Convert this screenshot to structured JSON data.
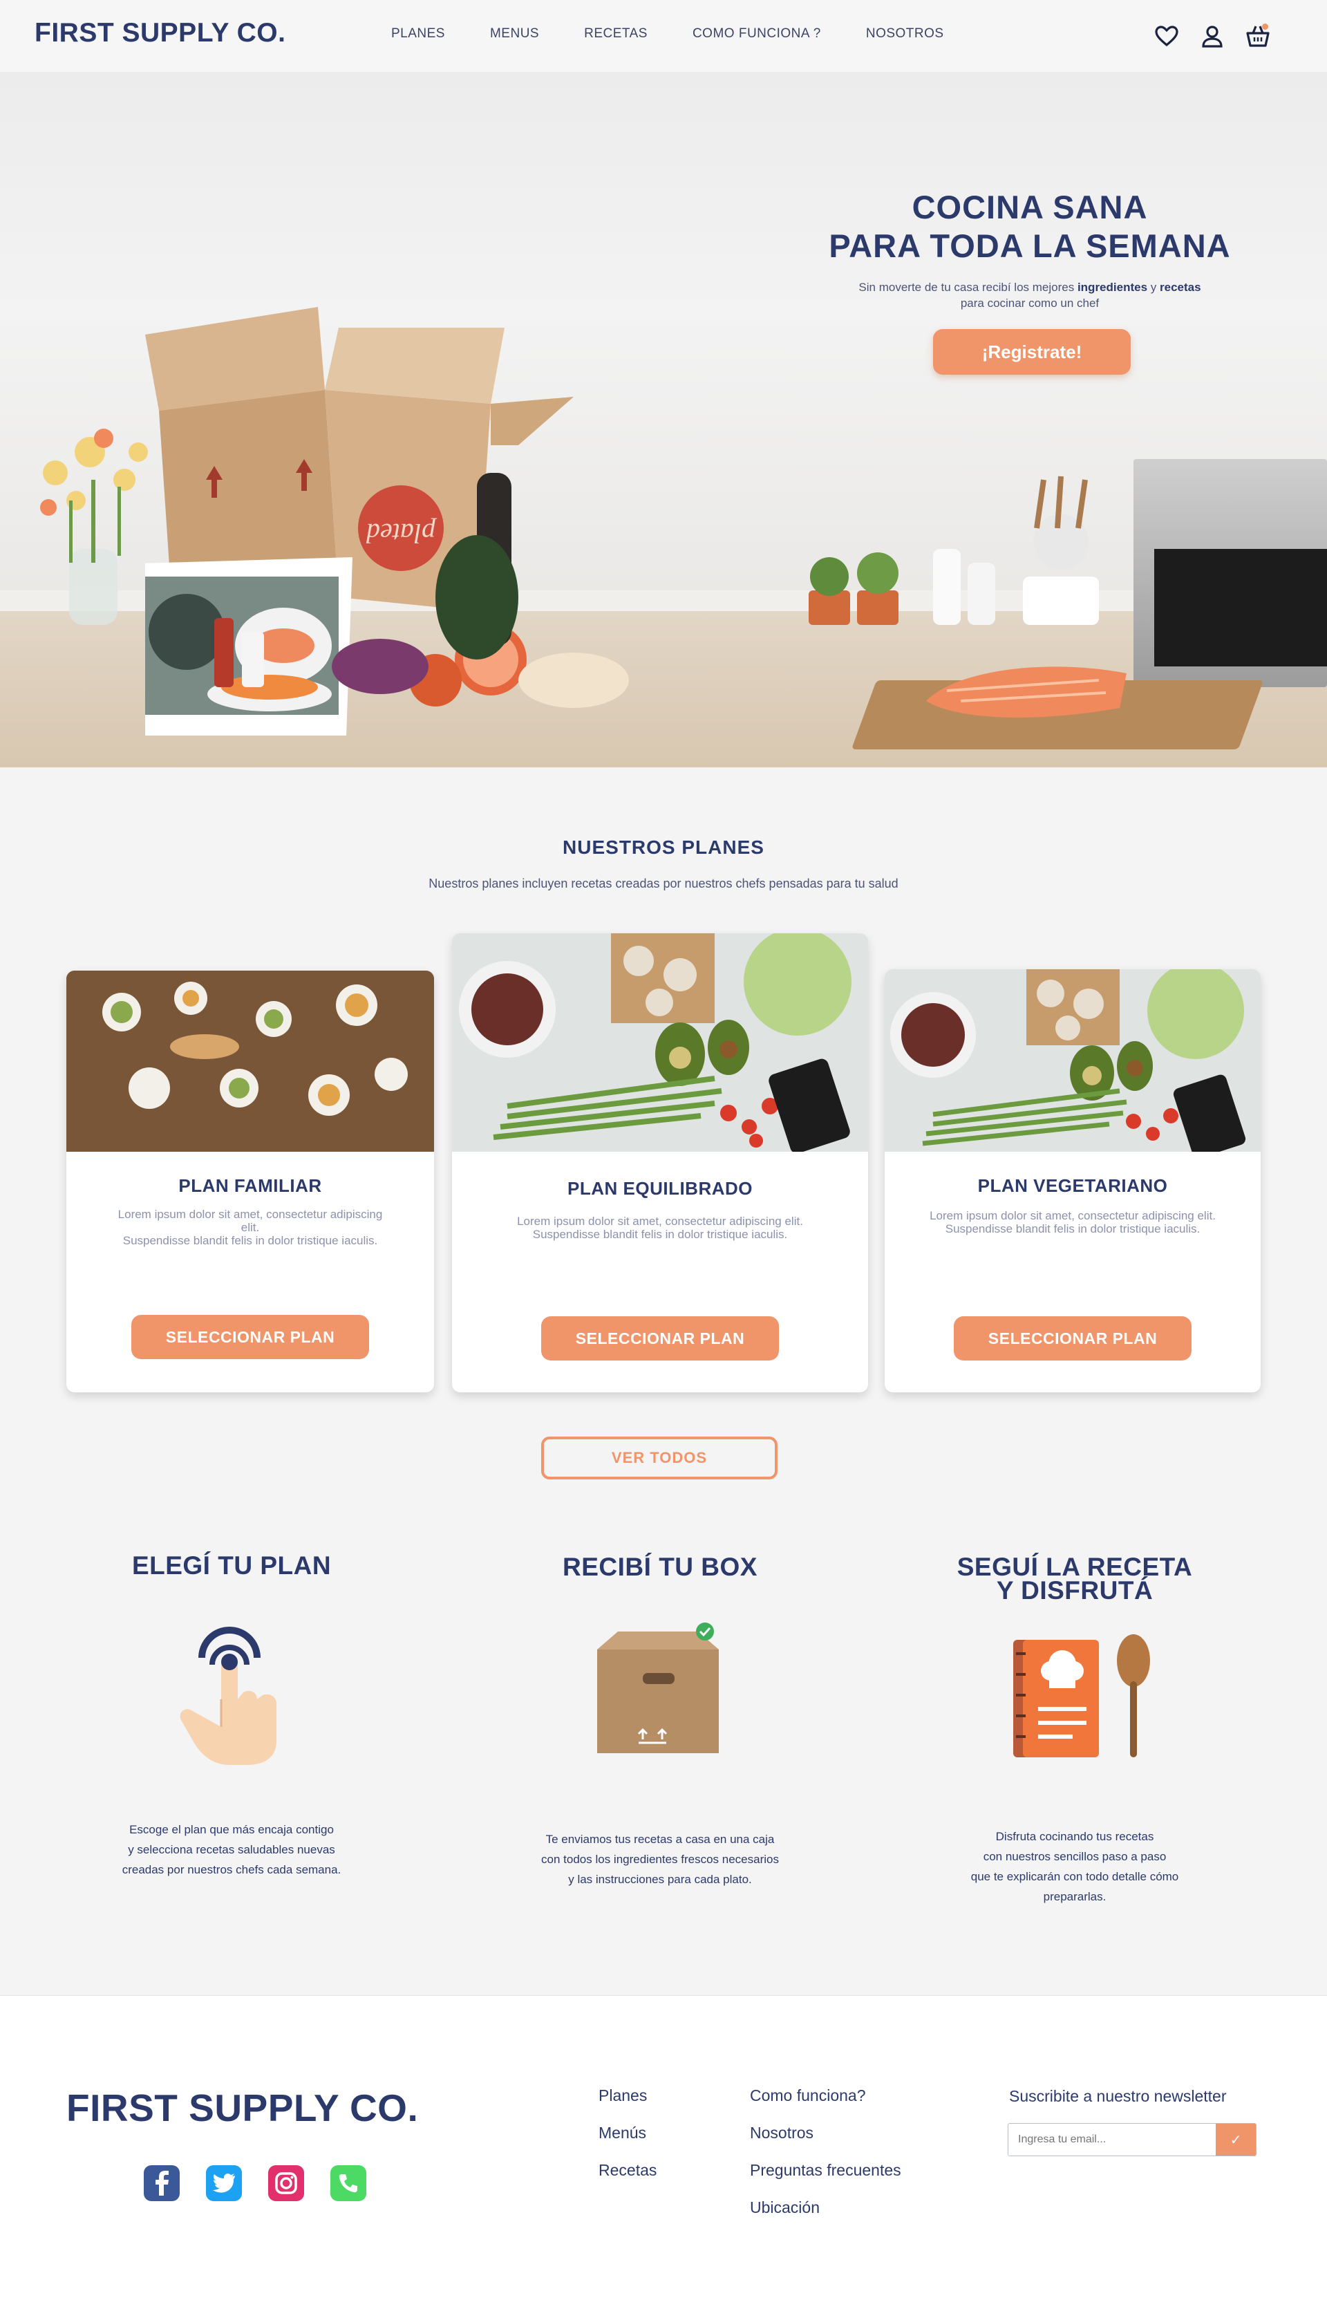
{
  "header": {
    "logo": "FIRST SUPPLY CO.",
    "menu": [
      "PLANES",
      "MENUS",
      "RECETAS",
      "COMO FUNCIONA ?",
      "NOSOTROS"
    ],
    "icons": [
      "heart-icon",
      "user-icon",
      "basket-icon"
    ]
  },
  "hero": {
    "title_line1": "COCINA SANA",
    "title_line2": "PARA TODA LA SEMANA",
    "subtitle_pre": "Sin moverte de tu casa recibí los mejores ",
    "subtitle_bold1": "ingredientes",
    "subtitle_mid": " y ",
    "subtitle_bold2": "recetas",
    "subtitle_line2": "para cocinar como un chef",
    "cta": "¡Registrate!",
    "box_brand": "plated"
  },
  "plans": {
    "title": "NUESTROS  PLANES",
    "subtitle": "Nuestros planes incluyen recetas creadas por nuestros chefs pensadas para tu salud",
    "cards": [
      {
        "name": "PLAN FAMILIAR",
        "desc1": "Lorem ipsum dolor sit amet, consectetur adipiscing elit.",
        "desc2": "Suspendisse blandit felis in dolor tristique iaculis.",
        "button": "SELECCIONAR PLAN"
      },
      {
        "name": "PLAN EQUILIBRADO",
        "desc1": "Lorem ipsum dolor sit amet, consectetur adipiscing elit.",
        "desc2": "Suspendisse blandit felis in dolor tristique iaculis.",
        "button": "SELECCIONAR PLAN"
      },
      {
        "name": "PLAN VEGETARIANO",
        "desc1": "Lorem ipsum dolor sit amet, consectetur adipiscing elit.",
        "desc2": "Suspendisse blandit felis in dolor tristique iaculis.",
        "button": "SELECCIONAR PLAN"
      }
    ],
    "see_all": "VER TODOS"
  },
  "steps": [
    {
      "title": "ELEGÍ TU PLAN",
      "icon": "tap-hand-icon",
      "text": [
        "Escoge el plan que más encaja contigo",
        "y selecciona recetas saludables nuevas",
        "creadas por nuestros chefs cada semana."
      ]
    },
    {
      "title": "RECIBÍ TU BOX",
      "icon": "box-icon",
      "text": [
        "Te enviamos tus recetas a casa en una caja",
        "con todos los ingredientes frescos necesarios",
        "y las instrucciones para cada plato."
      ]
    },
    {
      "title_line1": "SEGUÍ LA RECETA",
      "title_line2": "Y DISFRUTÁ",
      "icon": "recipe-book-icon",
      "text": [
        "Disfruta cocinando tus recetas",
        "con nuestros sencillos paso a paso",
        "que te explicarán con todo detalle cómo",
        "prepararlas."
      ]
    }
  ],
  "footer": {
    "logo": "FIRST SUPPLY CO.",
    "socials": [
      "facebook-icon",
      "twitter-icon",
      "instagram-icon",
      "phone-icon"
    ],
    "col1": [
      "Planes",
      "Menús",
      "Recetas"
    ],
    "col2": [
      "Como funciona?",
      "Nosotros",
      "Preguntas frecuentes",
      "Ubicación"
    ],
    "newsletter_title": "Suscribite a nuestro newsletter",
    "newsletter_placeholder": "Ingresa tu email...",
    "submit_glyph": "✓"
  },
  "colors": {
    "accent": "#f0946a",
    "navy": "#2c3a6b",
    "background": "#f4f4f5"
  }
}
